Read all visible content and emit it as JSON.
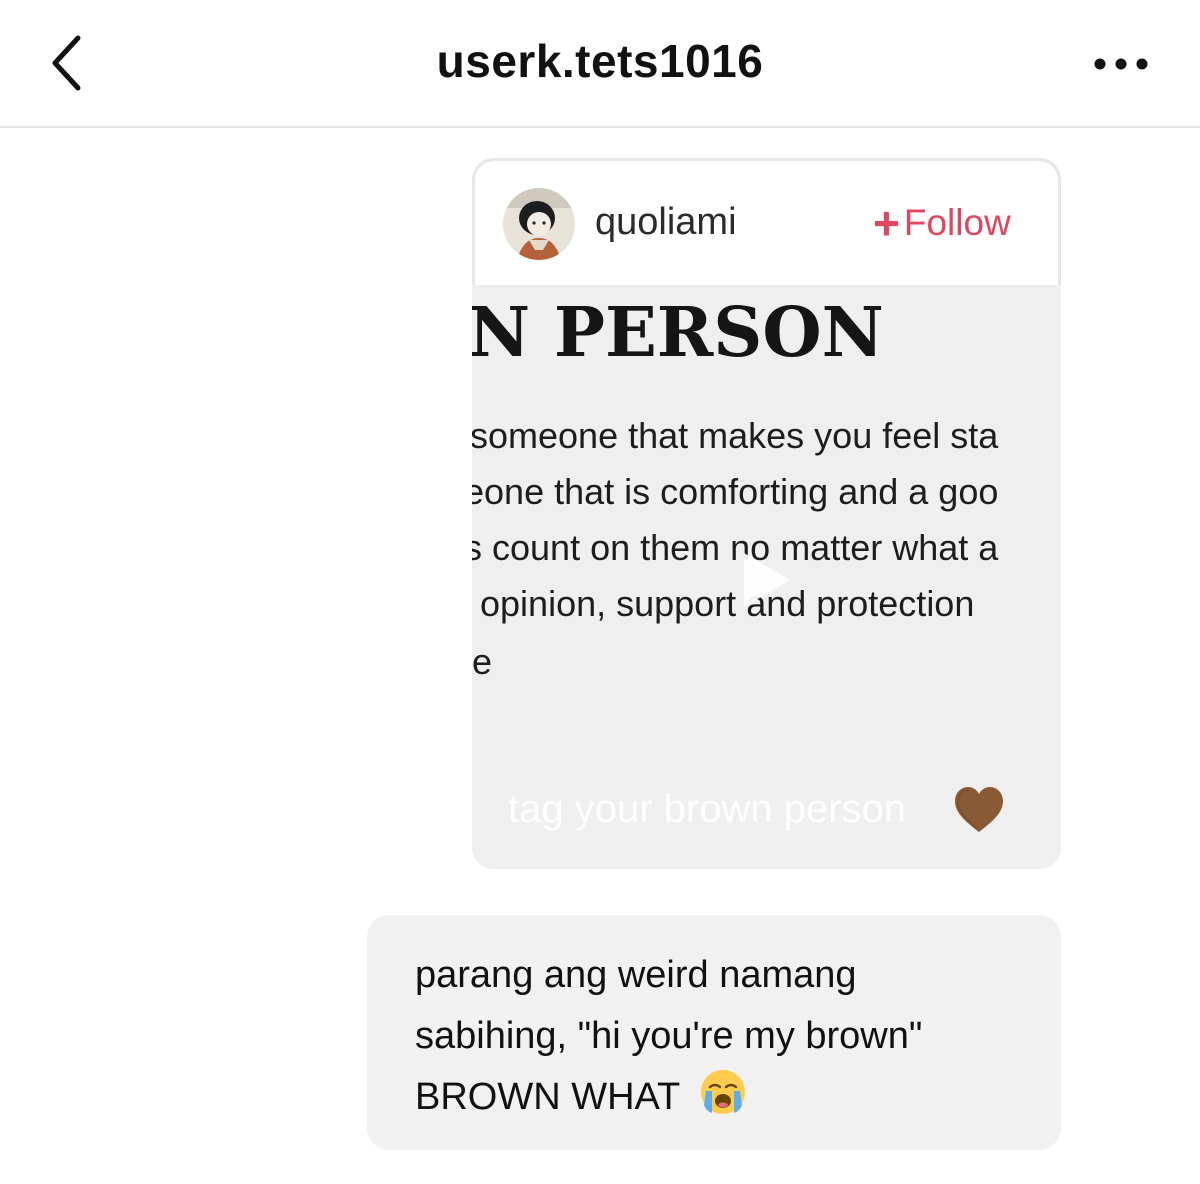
{
  "header": {
    "back_icon": "chevron-left-icon",
    "title": "userk.tets1016",
    "more_icon": "more-horizontal-icon"
  },
  "shared_post": {
    "owner": "quoliami",
    "follow_label": "Follow",
    "follow_color": "#e0475e",
    "video": {
      "heading": "N PERSON",
      "lines": [
        "someone that makes you feel sta",
        "eone that is comforting and a goo",
        "s count on them no matter what a",
        "t opinion, support and protection",
        "e"
      ],
      "caption": "tag your brown person",
      "caption_emoji": "brown-heart-icon",
      "play_icon": "play-icon"
    }
  },
  "message": {
    "lines": [
      "parang ang weird namang",
      "sabihing, \"hi you're my brown\"",
      "BROWN WHAT"
    ],
    "emoji": "loudly-crying-face-icon",
    "bubble_color": "#f1f1f1"
  }
}
